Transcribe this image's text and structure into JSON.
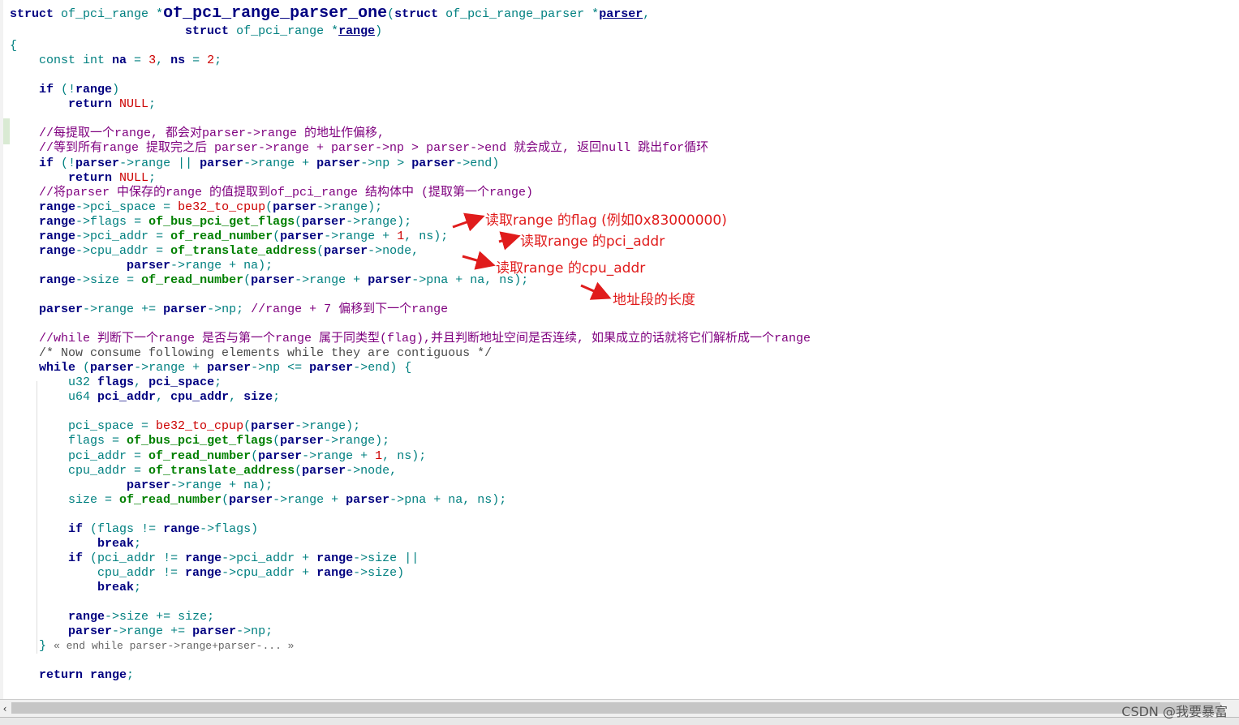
{
  "editor": {
    "lines": [
      [
        [
          "kw",
          "struct "
        ],
        [
          "id",
          "of_pci_range "
        ],
        [
          "punc",
          "*"
        ],
        [
          "title",
          "of_pci_range_parser_one"
        ],
        [
          "punc",
          "("
        ],
        [
          "kw",
          "struct "
        ],
        [
          "id",
          "of_pci_range_parser "
        ],
        [
          "punc",
          "*"
        ],
        [
          "var",
          "parser"
        ],
        [
          "punc",
          ","
        ]
      ],
      [
        [
          "id",
          "                        "
        ],
        [
          "kw",
          "struct "
        ],
        [
          "id",
          "of_pci_range "
        ],
        [
          "punc",
          "*"
        ],
        [
          "var",
          "range"
        ],
        [
          "punc",
          ")"
        ]
      ],
      [
        [
          "punc",
          "{"
        ]
      ],
      [
        [
          "id",
          "    const "
        ],
        [
          "id",
          "int "
        ],
        [
          "var",
          "na"
        ],
        [
          "op",
          " = "
        ],
        [
          "num",
          "3"
        ],
        [
          "punc",
          ", "
        ],
        [
          "var",
          "ns"
        ],
        [
          "op",
          " = "
        ],
        [
          "num",
          "2"
        ],
        [
          "punc",
          ";"
        ]
      ],
      [],
      [
        [
          "id",
          "    "
        ],
        [
          "kw",
          "if "
        ],
        [
          "punc",
          "(!"
        ],
        [
          "var",
          "range"
        ],
        [
          "punc",
          ")"
        ]
      ],
      [
        [
          "id",
          "        "
        ],
        [
          "kw",
          "return "
        ],
        [
          "macro",
          "NULL"
        ],
        [
          "punc",
          ";"
        ]
      ],
      [],
      [
        [
          "cmt",
          "    //每提取一个range, 都会对parser->range 的地址作偏移,"
        ]
      ],
      [
        [
          "cmt",
          "    //等到所有range 提取完之后 parser->range + parser->np > parser->end 就会成立, 返回null 跳出for循环"
        ]
      ],
      [
        [
          "id",
          "    "
        ],
        [
          "kw",
          "if "
        ],
        [
          "punc",
          "(!"
        ],
        [
          "var",
          "parser"
        ],
        [
          "op",
          "->"
        ],
        [
          "id",
          "range "
        ],
        [
          "op",
          "|| "
        ],
        [
          "var",
          "parser"
        ],
        [
          "op",
          "->"
        ],
        [
          "id",
          "range "
        ],
        [
          "op",
          "+ "
        ],
        [
          "var",
          "parser"
        ],
        [
          "op",
          "->"
        ],
        [
          "id",
          "np "
        ],
        [
          "op",
          "> "
        ],
        [
          "var",
          "parser"
        ],
        [
          "op",
          "->"
        ],
        [
          "id",
          "end"
        ],
        [
          "punc",
          ")"
        ]
      ],
      [
        [
          "id",
          "        "
        ],
        [
          "kw",
          "return "
        ],
        [
          "macro",
          "NULL"
        ],
        [
          "punc",
          ";"
        ]
      ],
      [
        [
          "cmt",
          "    //将parser 中保存的range 的值提取到of_pci_range 结构体中 (提取第一个range)"
        ]
      ],
      [
        [
          "id",
          "    "
        ],
        [
          "var",
          "range"
        ],
        [
          "op",
          "->"
        ],
        [
          "id",
          "pci_space "
        ],
        [
          "op",
          "= "
        ],
        [
          "macro",
          "be32_to_cpup"
        ],
        [
          "punc",
          "("
        ],
        [
          "var",
          "parser"
        ],
        [
          "op",
          "->"
        ],
        [
          "id",
          "range"
        ],
        [
          "punc",
          ");"
        ]
      ],
      [
        [
          "id",
          "    "
        ],
        [
          "var",
          "range"
        ],
        [
          "op",
          "->"
        ],
        [
          "id",
          "flags "
        ],
        [
          "op",
          "= "
        ],
        [
          "fn",
          "of_bus_pci_get_flags"
        ],
        [
          "punc",
          "("
        ],
        [
          "var",
          "parser"
        ],
        [
          "op",
          "->"
        ],
        [
          "id",
          "range"
        ],
        [
          "punc",
          ");"
        ]
      ],
      [
        [
          "id",
          "    "
        ],
        [
          "var",
          "range"
        ],
        [
          "op",
          "->"
        ],
        [
          "id",
          "pci_addr "
        ],
        [
          "op",
          "= "
        ],
        [
          "fn",
          "of_read_number"
        ],
        [
          "punc",
          "("
        ],
        [
          "var",
          "parser"
        ],
        [
          "op",
          "->"
        ],
        [
          "id",
          "range "
        ],
        [
          "op",
          "+ "
        ],
        [
          "num",
          "1"
        ],
        [
          "punc",
          ", "
        ],
        [
          "id",
          "ns"
        ],
        [
          "punc",
          ");"
        ]
      ],
      [
        [
          "id",
          "    "
        ],
        [
          "var",
          "range"
        ],
        [
          "op",
          "->"
        ],
        [
          "id",
          "cpu_addr "
        ],
        [
          "op",
          "= "
        ],
        [
          "fn",
          "of_translate_address"
        ],
        [
          "punc",
          "("
        ],
        [
          "var",
          "parser"
        ],
        [
          "op",
          "->"
        ],
        [
          "id",
          "node"
        ],
        [
          "punc",
          ","
        ]
      ],
      [
        [
          "id",
          "                "
        ],
        [
          "var",
          "parser"
        ],
        [
          "op",
          "->"
        ],
        [
          "id",
          "range "
        ],
        [
          "op",
          "+ "
        ],
        [
          "id",
          "na"
        ],
        [
          "punc",
          ");"
        ]
      ],
      [
        [
          "id",
          "    "
        ],
        [
          "var",
          "range"
        ],
        [
          "op",
          "->"
        ],
        [
          "id",
          "size "
        ],
        [
          "op",
          "= "
        ],
        [
          "fn",
          "of_read_number"
        ],
        [
          "punc",
          "("
        ],
        [
          "var",
          "parser"
        ],
        [
          "op",
          "->"
        ],
        [
          "id",
          "range "
        ],
        [
          "op",
          "+ "
        ],
        [
          "var",
          "parser"
        ],
        [
          "op",
          "->"
        ],
        [
          "id",
          "pna "
        ],
        [
          "op",
          "+ "
        ],
        [
          "id",
          "na"
        ],
        [
          "punc",
          ", "
        ],
        [
          "id",
          "ns"
        ],
        [
          "punc",
          ");"
        ]
      ],
      [],
      [
        [
          "id",
          "    "
        ],
        [
          "var",
          "parser"
        ],
        [
          "op",
          "->"
        ],
        [
          "id",
          "range "
        ],
        [
          "op",
          "+= "
        ],
        [
          "var",
          "parser"
        ],
        [
          "op",
          "->"
        ],
        [
          "id",
          "np"
        ],
        [
          "punc",
          "; "
        ],
        [
          "cmt",
          "//range + 7 偏移到下一个range"
        ]
      ],
      [],
      [
        [
          "cmt",
          "    //while 判断下一个range 是否与第一个range 属于同类型(flag),并且判断地址空间是否连续, 如果成立的话就将它们解析成一个range"
        ]
      ],
      [
        [
          "cmt2",
          "    /* Now consume following elements while they are contiguous */"
        ]
      ],
      [
        [
          "id",
          "    "
        ],
        [
          "kw",
          "while "
        ],
        [
          "punc",
          "("
        ],
        [
          "var",
          "parser"
        ],
        [
          "op",
          "->"
        ],
        [
          "id",
          "range "
        ],
        [
          "op",
          "+ "
        ],
        [
          "var",
          "parser"
        ],
        [
          "op",
          "->"
        ],
        [
          "id",
          "np "
        ],
        [
          "op",
          "<= "
        ],
        [
          "var",
          "parser"
        ],
        [
          "op",
          "->"
        ],
        [
          "id",
          "end"
        ],
        [
          "punc",
          ") {"
        ]
      ],
      [
        [
          "id",
          "        u32 "
        ],
        [
          "var",
          "flags"
        ],
        [
          "punc",
          ", "
        ],
        [
          "var",
          "pci_space"
        ],
        [
          "punc",
          ";"
        ]
      ],
      [
        [
          "id",
          "        u64 "
        ],
        [
          "var",
          "pci_addr"
        ],
        [
          "punc",
          ", "
        ],
        [
          "var",
          "cpu_addr"
        ],
        [
          "punc",
          ", "
        ],
        [
          "var",
          "size"
        ],
        [
          "punc",
          ";"
        ]
      ],
      [],
      [
        [
          "id",
          "        pci_space "
        ],
        [
          "op",
          "= "
        ],
        [
          "macro",
          "be32_to_cpup"
        ],
        [
          "punc",
          "("
        ],
        [
          "var",
          "parser"
        ],
        [
          "op",
          "->"
        ],
        [
          "id",
          "range"
        ],
        [
          "punc",
          ");"
        ]
      ],
      [
        [
          "id",
          "        flags "
        ],
        [
          "op",
          "= "
        ],
        [
          "fn",
          "of_bus_pci_get_flags"
        ],
        [
          "punc",
          "("
        ],
        [
          "var",
          "parser"
        ],
        [
          "op",
          "->"
        ],
        [
          "id",
          "range"
        ],
        [
          "punc",
          ");"
        ]
      ],
      [
        [
          "id",
          "        pci_addr "
        ],
        [
          "op",
          "= "
        ],
        [
          "fn",
          "of_read_number"
        ],
        [
          "punc",
          "("
        ],
        [
          "var",
          "parser"
        ],
        [
          "op",
          "->"
        ],
        [
          "id",
          "range "
        ],
        [
          "op",
          "+ "
        ],
        [
          "num",
          "1"
        ],
        [
          "punc",
          ", "
        ],
        [
          "id",
          "ns"
        ],
        [
          "punc",
          ");"
        ]
      ],
      [
        [
          "id",
          "        cpu_addr "
        ],
        [
          "op",
          "= "
        ],
        [
          "fn",
          "of_translate_address"
        ],
        [
          "punc",
          "("
        ],
        [
          "var",
          "parser"
        ],
        [
          "op",
          "->"
        ],
        [
          "id",
          "node"
        ],
        [
          "punc",
          ","
        ]
      ],
      [
        [
          "id",
          "                "
        ],
        [
          "var",
          "parser"
        ],
        [
          "op",
          "->"
        ],
        [
          "id",
          "range "
        ],
        [
          "op",
          "+ "
        ],
        [
          "id",
          "na"
        ],
        [
          "punc",
          ");"
        ]
      ],
      [
        [
          "id",
          "        size "
        ],
        [
          "op",
          "= "
        ],
        [
          "fn",
          "of_read_number"
        ],
        [
          "punc",
          "("
        ],
        [
          "var",
          "parser"
        ],
        [
          "op",
          "->"
        ],
        [
          "id",
          "range "
        ],
        [
          "op",
          "+ "
        ],
        [
          "var",
          "parser"
        ],
        [
          "op",
          "->"
        ],
        [
          "id",
          "pna "
        ],
        [
          "op",
          "+ "
        ],
        [
          "id",
          "na"
        ],
        [
          "punc",
          ", "
        ],
        [
          "id",
          "ns"
        ],
        [
          "punc",
          ");"
        ]
      ],
      [],
      [
        [
          "id",
          "        "
        ],
        [
          "kw",
          "if "
        ],
        [
          "punc",
          "("
        ],
        [
          "id",
          "flags "
        ],
        [
          "op",
          "!= "
        ],
        [
          "var",
          "range"
        ],
        [
          "op",
          "->"
        ],
        [
          "id",
          "flags"
        ],
        [
          "punc",
          ")"
        ]
      ],
      [
        [
          "id",
          "            "
        ],
        [
          "kw",
          "break"
        ],
        [
          "punc",
          ";"
        ]
      ],
      [
        [
          "id",
          "        "
        ],
        [
          "kw",
          "if "
        ],
        [
          "punc",
          "("
        ],
        [
          "id",
          "pci_addr "
        ],
        [
          "op",
          "!= "
        ],
        [
          "var",
          "range"
        ],
        [
          "op",
          "->"
        ],
        [
          "id",
          "pci_addr "
        ],
        [
          "op",
          "+ "
        ],
        [
          "var",
          "range"
        ],
        [
          "op",
          "->"
        ],
        [
          "id",
          "size "
        ],
        [
          "op",
          "||"
        ]
      ],
      [
        [
          "id",
          "            cpu_addr "
        ],
        [
          "op",
          "!= "
        ],
        [
          "var",
          "range"
        ],
        [
          "op",
          "->"
        ],
        [
          "id",
          "cpu_addr "
        ],
        [
          "op",
          "+ "
        ],
        [
          "var",
          "range"
        ],
        [
          "op",
          "->"
        ],
        [
          "id",
          "size"
        ],
        [
          "punc",
          ")"
        ]
      ],
      [
        [
          "id",
          "            "
        ],
        [
          "kw",
          "break"
        ],
        [
          "punc",
          ";"
        ]
      ],
      [],
      [
        [
          "id",
          "        "
        ],
        [
          "var",
          "range"
        ],
        [
          "op",
          "->"
        ],
        [
          "id",
          "size "
        ],
        [
          "op",
          "+= "
        ],
        [
          "id",
          "size"
        ],
        [
          "punc",
          ";"
        ]
      ],
      [
        [
          "id",
          "        "
        ],
        [
          "var",
          "parser"
        ],
        [
          "op",
          "->"
        ],
        [
          "id",
          "range "
        ],
        [
          "op",
          "+= "
        ],
        [
          "var",
          "parser"
        ],
        [
          "op",
          "->"
        ],
        [
          "id",
          "np"
        ],
        [
          "punc",
          ";"
        ]
      ],
      [
        [
          "id",
          "    "
        ],
        [
          "punc",
          "} "
        ],
        [
          "fold",
          "« end while parser->range+parser-... »"
        ]
      ],
      [],
      [
        [
          "id",
          "    "
        ],
        [
          "kw",
          "return "
        ],
        [
          "var",
          "range"
        ],
        [
          "punc",
          ";"
        ]
      ]
    ]
  },
  "annotations": [
    {
      "text": "读取range 的flag (例如0x83000000)"
    },
    {
      "text": "读取range 的pci_addr"
    },
    {
      "text": "读取range 的cpu_addr"
    },
    {
      "text": "地址段的长度"
    }
  ],
  "scrollbar": {
    "left_arrow": "‹"
  },
  "watermark": "CSDN @我要暴富",
  "colors": {
    "annotation": "#e01c1c",
    "keyword": "#000080",
    "function": "#008000",
    "identifier": "#008080",
    "macro": "#cc0000",
    "comment": "#7f007f"
  }
}
